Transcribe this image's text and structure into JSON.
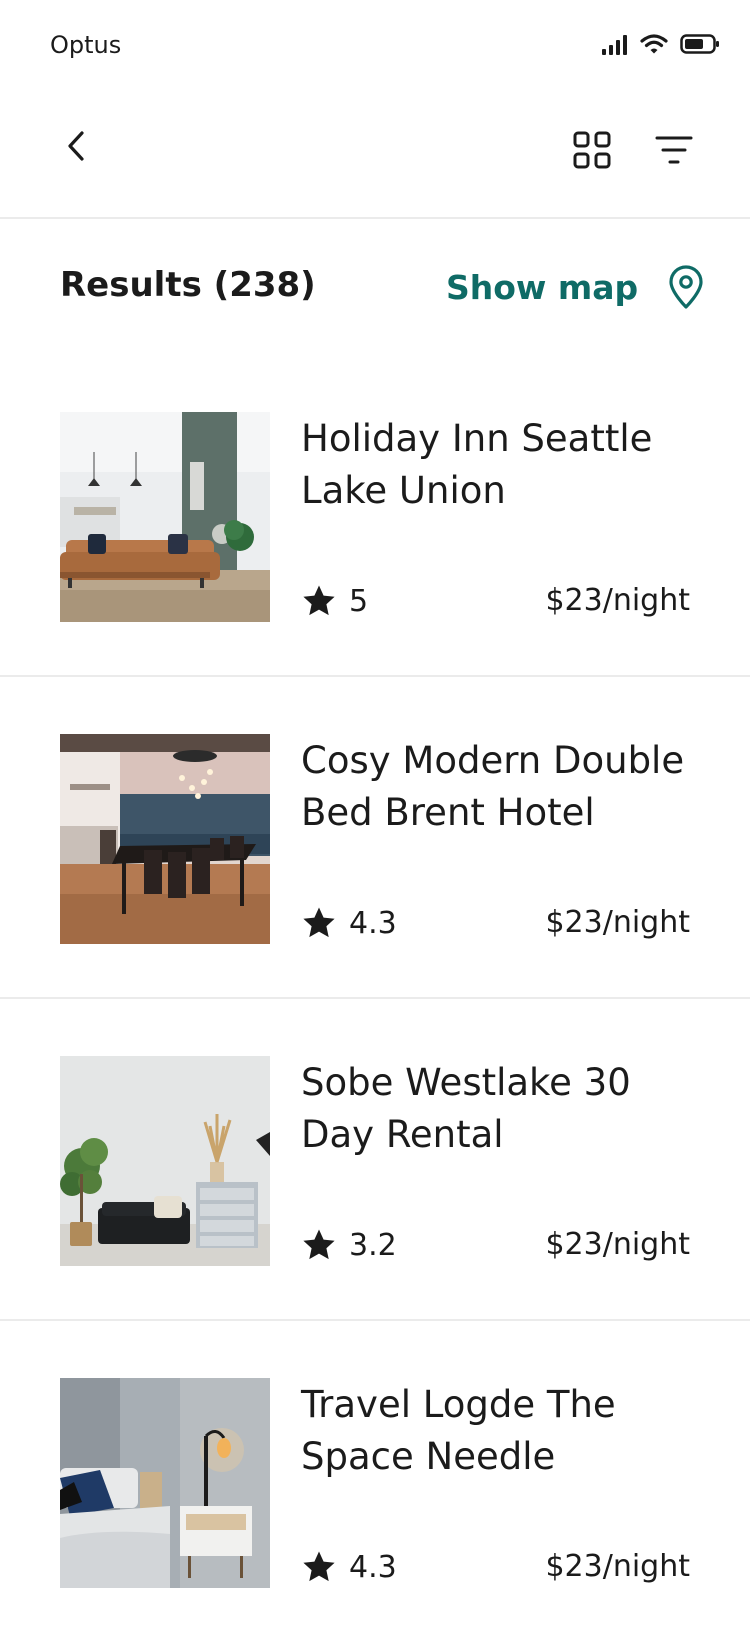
{
  "status_bar": {
    "carrier": "Optus",
    "icons": [
      "signal-icon",
      "wifi-icon",
      "battery-icon"
    ]
  },
  "header": {
    "back_icon": "chevron-left-icon",
    "grid_icon": "grid-view-icon",
    "filter_icon": "filter-icon"
  },
  "results": {
    "title": "Results (238)",
    "show_map_label": "Show map",
    "map_icon": "map-pin-icon",
    "accent_color": "#0f6b66"
  },
  "listings": [
    {
      "title": "Holiday Inn Seattle Lake Union",
      "rating": "5",
      "price": "$23/night",
      "image": "living-room-photo"
    },
    {
      "title": "Cosy Modern Double Bed Brent Hotel",
      "rating": "4.3",
      "price": "$23/night",
      "image": "dining-room-photo"
    },
    {
      "title": "Sobe Westlake 30 Day Rental",
      "rating": "3.2",
      "price": "$23/night",
      "image": "lounge-photo"
    },
    {
      "title": "Travel Logde The Space Needle",
      "rating": "4.3",
      "price": "$23/night",
      "image": "bedroom-photo"
    }
  ]
}
